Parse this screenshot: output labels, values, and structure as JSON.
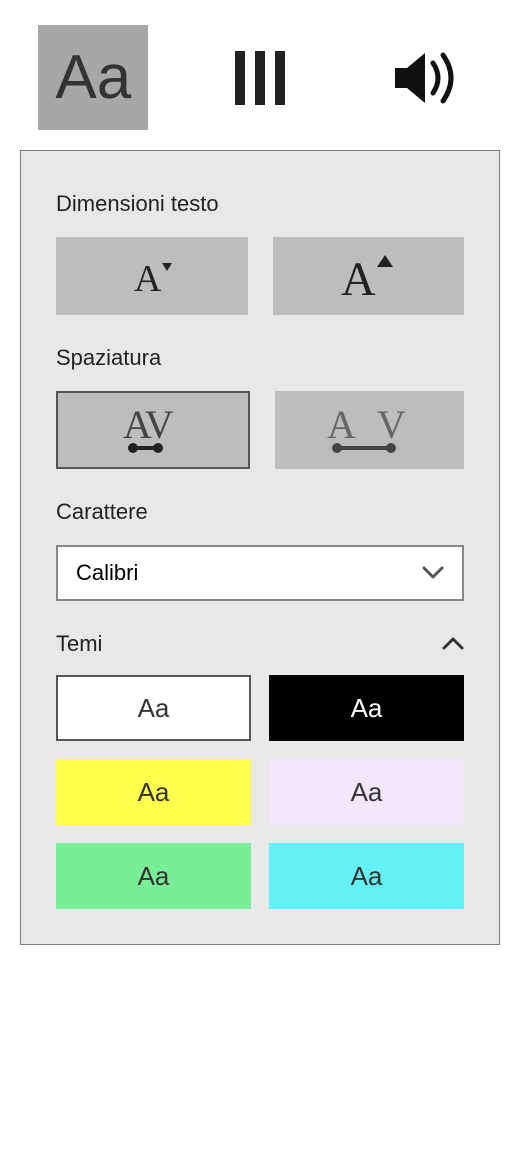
{
  "tabs": {
    "text": {
      "label": "Aa",
      "active": true
    },
    "columns": {
      "active": false
    },
    "audio": {
      "active": false
    }
  },
  "sections": {
    "textSize": {
      "label": "Dimensioni testo"
    },
    "spacing": {
      "label": "Spaziatura"
    },
    "font": {
      "label": "Carattere",
      "value": "Calibri"
    },
    "themes": {
      "label": "Temi"
    }
  },
  "themes": [
    {
      "bg": "#ffffff",
      "fg": "#333333",
      "label": "Aa",
      "selected": true
    },
    {
      "bg": "#000000",
      "fg": "#ffffff",
      "label": "Aa",
      "selected": false
    },
    {
      "bg": "#ffff4d",
      "fg": "#333333",
      "label": "Aa",
      "selected": false
    },
    {
      "bg": "#f6e6fb",
      "fg": "#333333",
      "label": "Aa",
      "selected": false
    },
    {
      "bg": "#78ee96",
      "fg": "#333333",
      "label": "Aa",
      "selected": false
    },
    {
      "bg": "#63f1f5",
      "fg": "#333333",
      "label": "Aa",
      "selected": false
    }
  ]
}
